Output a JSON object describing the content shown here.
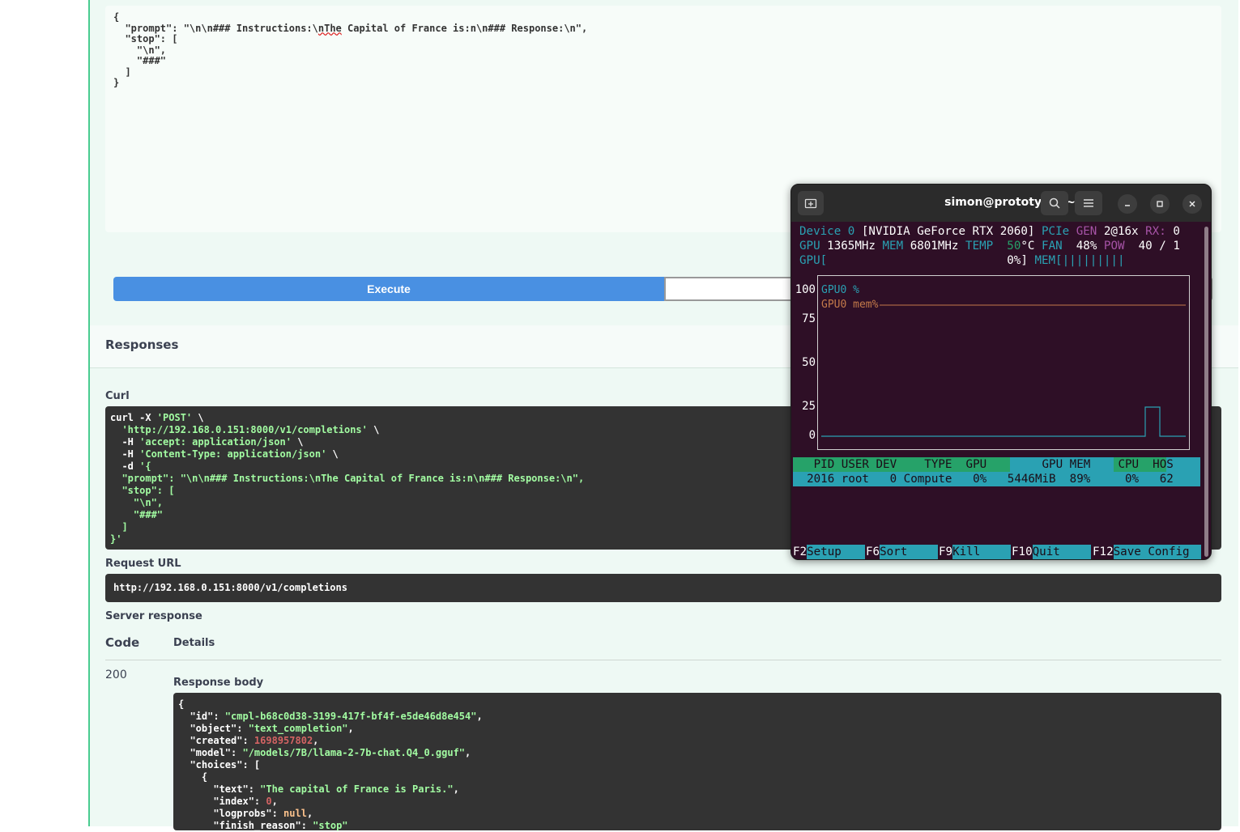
{
  "request_body": {
    "line1": "{",
    "prompt_key": "\"prompt\"",
    "prompt_pre": "\"\\n\\n### Instructions:\\",
    "prompt_squig": "nThe",
    "prompt_post": " Capital of France is:n\\n### Response:\\n\",",
    "stop_line": "  \"stop\": [",
    "stop_item1": "    \"\\n\",",
    "stop_item2": "    \"###\"",
    "close_bracket": "  ]",
    "close_brace": "}"
  },
  "execute_label": "Execute",
  "responses_title": "Responses",
  "curl_label": "Curl",
  "curl_lines": [
    "curl -X ",
    "'POST'",
    " \\",
    "  'http://192.168.0.151:8000/v1/completions'",
    " \\",
    "  -H ",
    "'accept: application/json'",
    " \\",
    "  -H ",
    "'Content-Type: application/json'",
    " \\",
    "  -d ",
    "'{",
    "  \"prompt\": \"\\n\\n### Instructions:\\nThe Capital of France is:n\\n### Response:\\n\",",
    "  \"stop\": [",
    "    \"\\n\",",
    "    \"###\"",
    "  ]",
    "}'"
  ],
  "request_url_label": "Request URL",
  "request_url": "http://192.168.0.151:8000/v1/completions",
  "server_response_label": "Server response",
  "code_header": "Code",
  "details_header": "Details",
  "status_code": "200",
  "response_body_label": "Response body",
  "response_body": {
    "open": "{",
    "id_key": "  \"id\": ",
    "id_val": "\"cmpl-b68c0d38-3199-417f-bf4f-e5de46d8e454\"",
    "object_key": "  \"object\": ",
    "object_val": "\"text_completion\"",
    "created_key": "  \"created\": ",
    "created_val": "1698957802",
    "model_key": "  \"model\": ",
    "model_val": "\"/models/7B/llama-2-7b-chat.Q4_0.gguf\"",
    "choices_key": "  \"choices\": [",
    "choices_open": "    {",
    "text_key": "      \"text\": ",
    "text_val": "\"The capital of France is Paris.\"",
    "index_key": "      \"index\": ",
    "index_val": "0",
    "logprobs_key": "      \"logprobs\": ",
    "logprobs_val": "null",
    "finish_key": "      \"finish_reason\": ",
    "finish_val": "\"stop\""
  },
  "terminal": {
    "title": "simon@prototype: ~",
    "device_label": "Device 0",
    "device_name": "[NVIDIA GeForce RTX 2060]",
    "pcie": "PCIe",
    "gen": "GEN",
    "gen_val": "2@16x",
    "rx": "RX:",
    "rx_val": "0",
    "gpu_label": "GPU",
    "gpu_clock": "1365MHz",
    "mem_label": "MEM",
    "mem_clock": "6801MHz",
    "temp_label": "TEMP",
    "temp_val": "50",
    "temp_unit": "°C",
    "fan_label": "FAN",
    "fan_val": "48%",
    "pow_label": "POW",
    "pow_val": "40 / 1",
    "gpu_bar_label": "GPU[",
    "gpu_bar_val": "0%]",
    "mem_bar_label": "MEM[",
    "mem_bar_fill": "|||||||||",
    "y_ticks": [
      "100",
      "75",
      "50",
      "25",
      "0"
    ],
    "legend_gpu": "GPU0 %",
    "legend_mem": "GPU0 mem%",
    "proc_header": "   PID USER DEV    TYPE  GPU        GPU MEM    CPU  HOS",
    "proc_row": "  2016 root   0 Compute   0%   5446MiB  89%     0%   62",
    "fkeys": [
      {
        "key": "F2",
        "label": "Setup"
      },
      {
        "key": "F6",
        "label": "Sort"
      },
      {
        "key": "F9",
        "label": "Kill"
      },
      {
        "key": "F10",
        "label": "Quit"
      },
      {
        "key": "F12",
        "label": "Save Config"
      }
    ]
  },
  "colors": {
    "swagger_green": "#49cc90",
    "execute_blue": "#4990e2",
    "terminal_bg": "#2e0f26",
    "terminal_cyan": "#2aa1b3"
  }
}
